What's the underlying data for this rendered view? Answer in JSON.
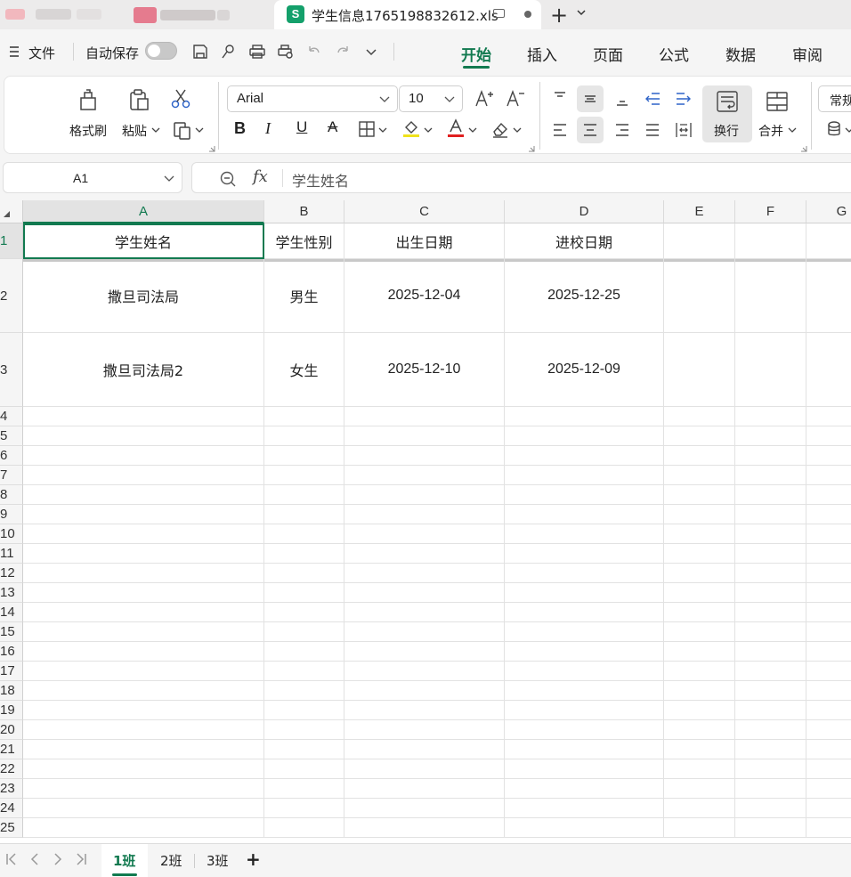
{
  "doc_tab": {
    "logo": "S",
    "title": "学生信息1765198832612.xls",
    "icons": [
      "monitor-icon",
      "unsaved-dot-icon"
    ]
  },
  "new_tab": "+",
  "menu": {
    "file_label": "文件",
    "autosave_label": "自动保存",
    "autosave_on": false,
    "quick_icons": [
      "save-icon",
      "export-icon",
      "print-icon",
      "print-preview-icon",
      "undo-icon",
      "redo-icon",
      "more-icon"
    ]
  },
  "ribbon_tabs": [
    "开始",
    "插入",
    "页面",
    "公式",
    "数据",
    "审阅"
  ],
  "ribbon_active_tab": "开始",
  "ribbon": {
    "format_painter": "格式刷",
    "paste": "粘贴",
    "font_name": "Arial",
    "font_size": "10",
    "wrap_text": "换行",
    "merge": "合并",
    "number_format": "常规",
    "accent": "#127a50",
    "fill_color": "#f0e21b",
    "font_color": "#e02020"
  },
  "formula_bar": {
    "cell_ref": "A1",
    "fx": "fx",
    "content": "学生姓名"
  },
  "columns": [
    "A",
    "B",
    "C",
    "D",
    "E",
    "F",
    "G"
  ],
  "active_column": "A",
  "rows": [
    "1",
    "2",
    "3",
    "4",
    "5",
    "6",
    "7",
    "8",
    "9",
    "10",
    "11",
    "12",
    "13",
    "14",
    "15",
    "16",
    "17",
    "18",
    "19",
    "20",
    "21",
    "22",
    "23",
    "24",
    "25"
  ],
  "active_row": "1",
  "cells": [
    [
      "学生姓名",
      "学生性别",
      "出生日期",
      "进校日期"
    ],
    [
      "撒旦司法局",
      "男生",
      "2025-12-04",
      "2025-12-25"
    ],
    [
      "撒旦司法局2",
      "女生",
      "2025-12-10",
      "2025-12-09"
    ]
  ],
  "sheets": [
    "1班",
    "2班",
    "3班"
  ],
  "active_sheet": "1班",
  "add_sheet": "+"
}
